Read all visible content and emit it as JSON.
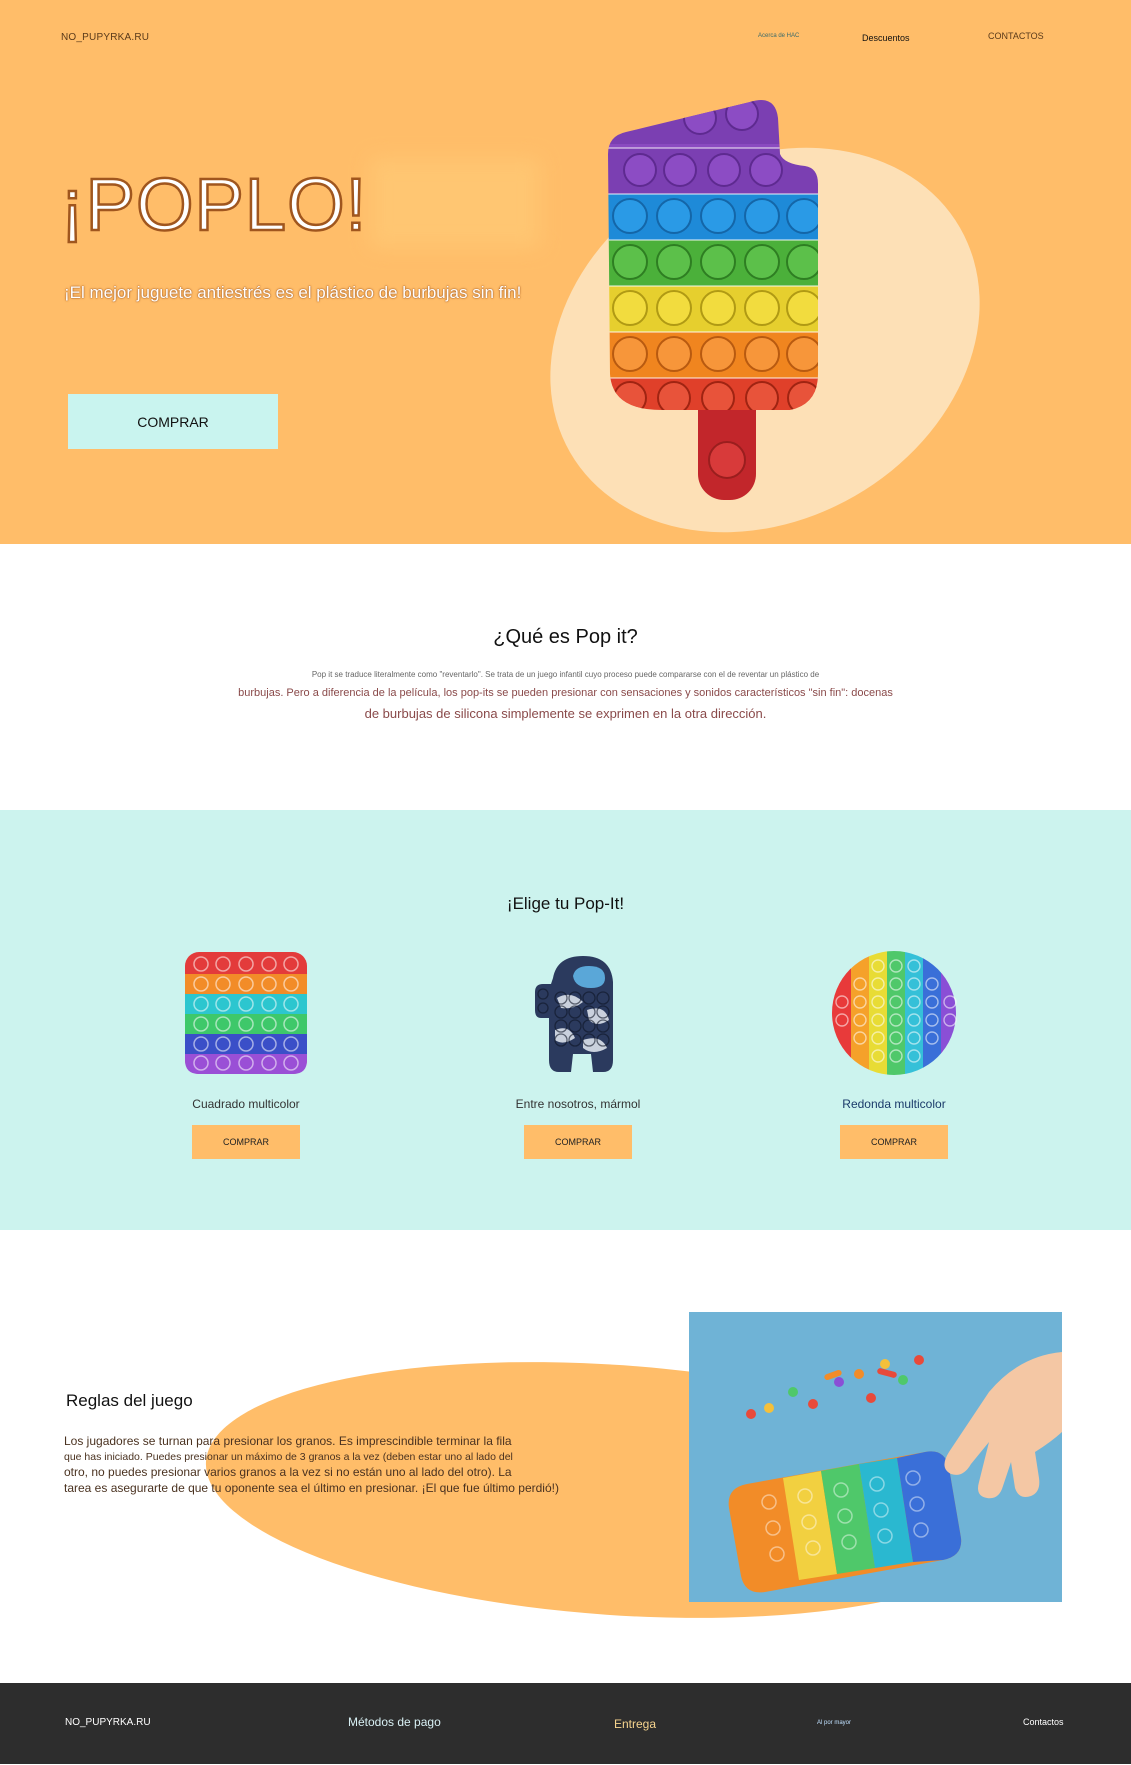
{
  "header": {
    "brand": "NO_PUPYRKA.RU",
    "nav": {
      "about": "Acerca de HAC",
      "discounts": "Descuentos",
      "contacts": "CONTACTOS"
    }
  },
  "hero": {
    "title": "¡POPLO!",
    "subtitle": "¡El mejor juguete antiestrés es el plástico de burbujas sin fin!",
    "buy_label": "COMPRAR"
  },
  "about": {
    "title": "¿Qué es Pop it?",
    "line1": "Pop it se traduce literalmente como \"reventarlo\". Se trata de un juego infantil cuyo proceso puede compararse con el de reventar un plástico de",
    "line2": "burbujas. Pero a diferencia de la película, los pop-its se pueden presionar con sensaciones y sonidos característicos \"sin fin\": docenas",
    "line3": "de burbujas de silicona simplemente se exprimen en la otra dirección."
  },
  "products": {
    "title": "¡Elige tu Pop-It!",
    "items": [
      {
        "name": "Cuadrado multicolor",
        "buy_label": "COMPRAR",
        "icon": "square-rainbow-popit"
      },
      {
        "name": "Entre nosotros, mármol",
        "buy_label": "COMPRAR",
        "icon": "among-us-marble-popit"
      },
      {
        "name": "Redonda multicolor",
        "buy_label": "COMPRAR",
        "icon": "round-rainbow-popit"
      }
    ]
  },
  "rules": {
    "title": "Reglas del juego",
    "line1": "Los jugadores se turnan para presionar los granos. Es imprescindible terminar la fila",
    "line2": " que has iniciado. Puedes presionar un máximo de 3 granos a la vez (deben estar uno al lado del",
    "line3": "otro, no puedes presionar varios granos a la vez si no están uno al lado del otro). La",
    "line4": "tarea es asegurarte de que tu oponente sea el último en presionar. ¡El que fue último perdió!)"
  },
  "footer": {
    "brand": "NO_PUPYRKA.RU",
    "payment": "Métodos de pago",
    "delivery": "Entrega",
    "wholesale": "Al por mayor",
    "contacts": "Contactos"
  },
  "colors": {
    "hero_bg": "#ffbd69",
    "mint": "#ccf3ee",
    "footer_bg": "#2d2d2d",
    "button_orange": "#ffbd69",
    "button_mint": "#c9f4ef"
  }
}
